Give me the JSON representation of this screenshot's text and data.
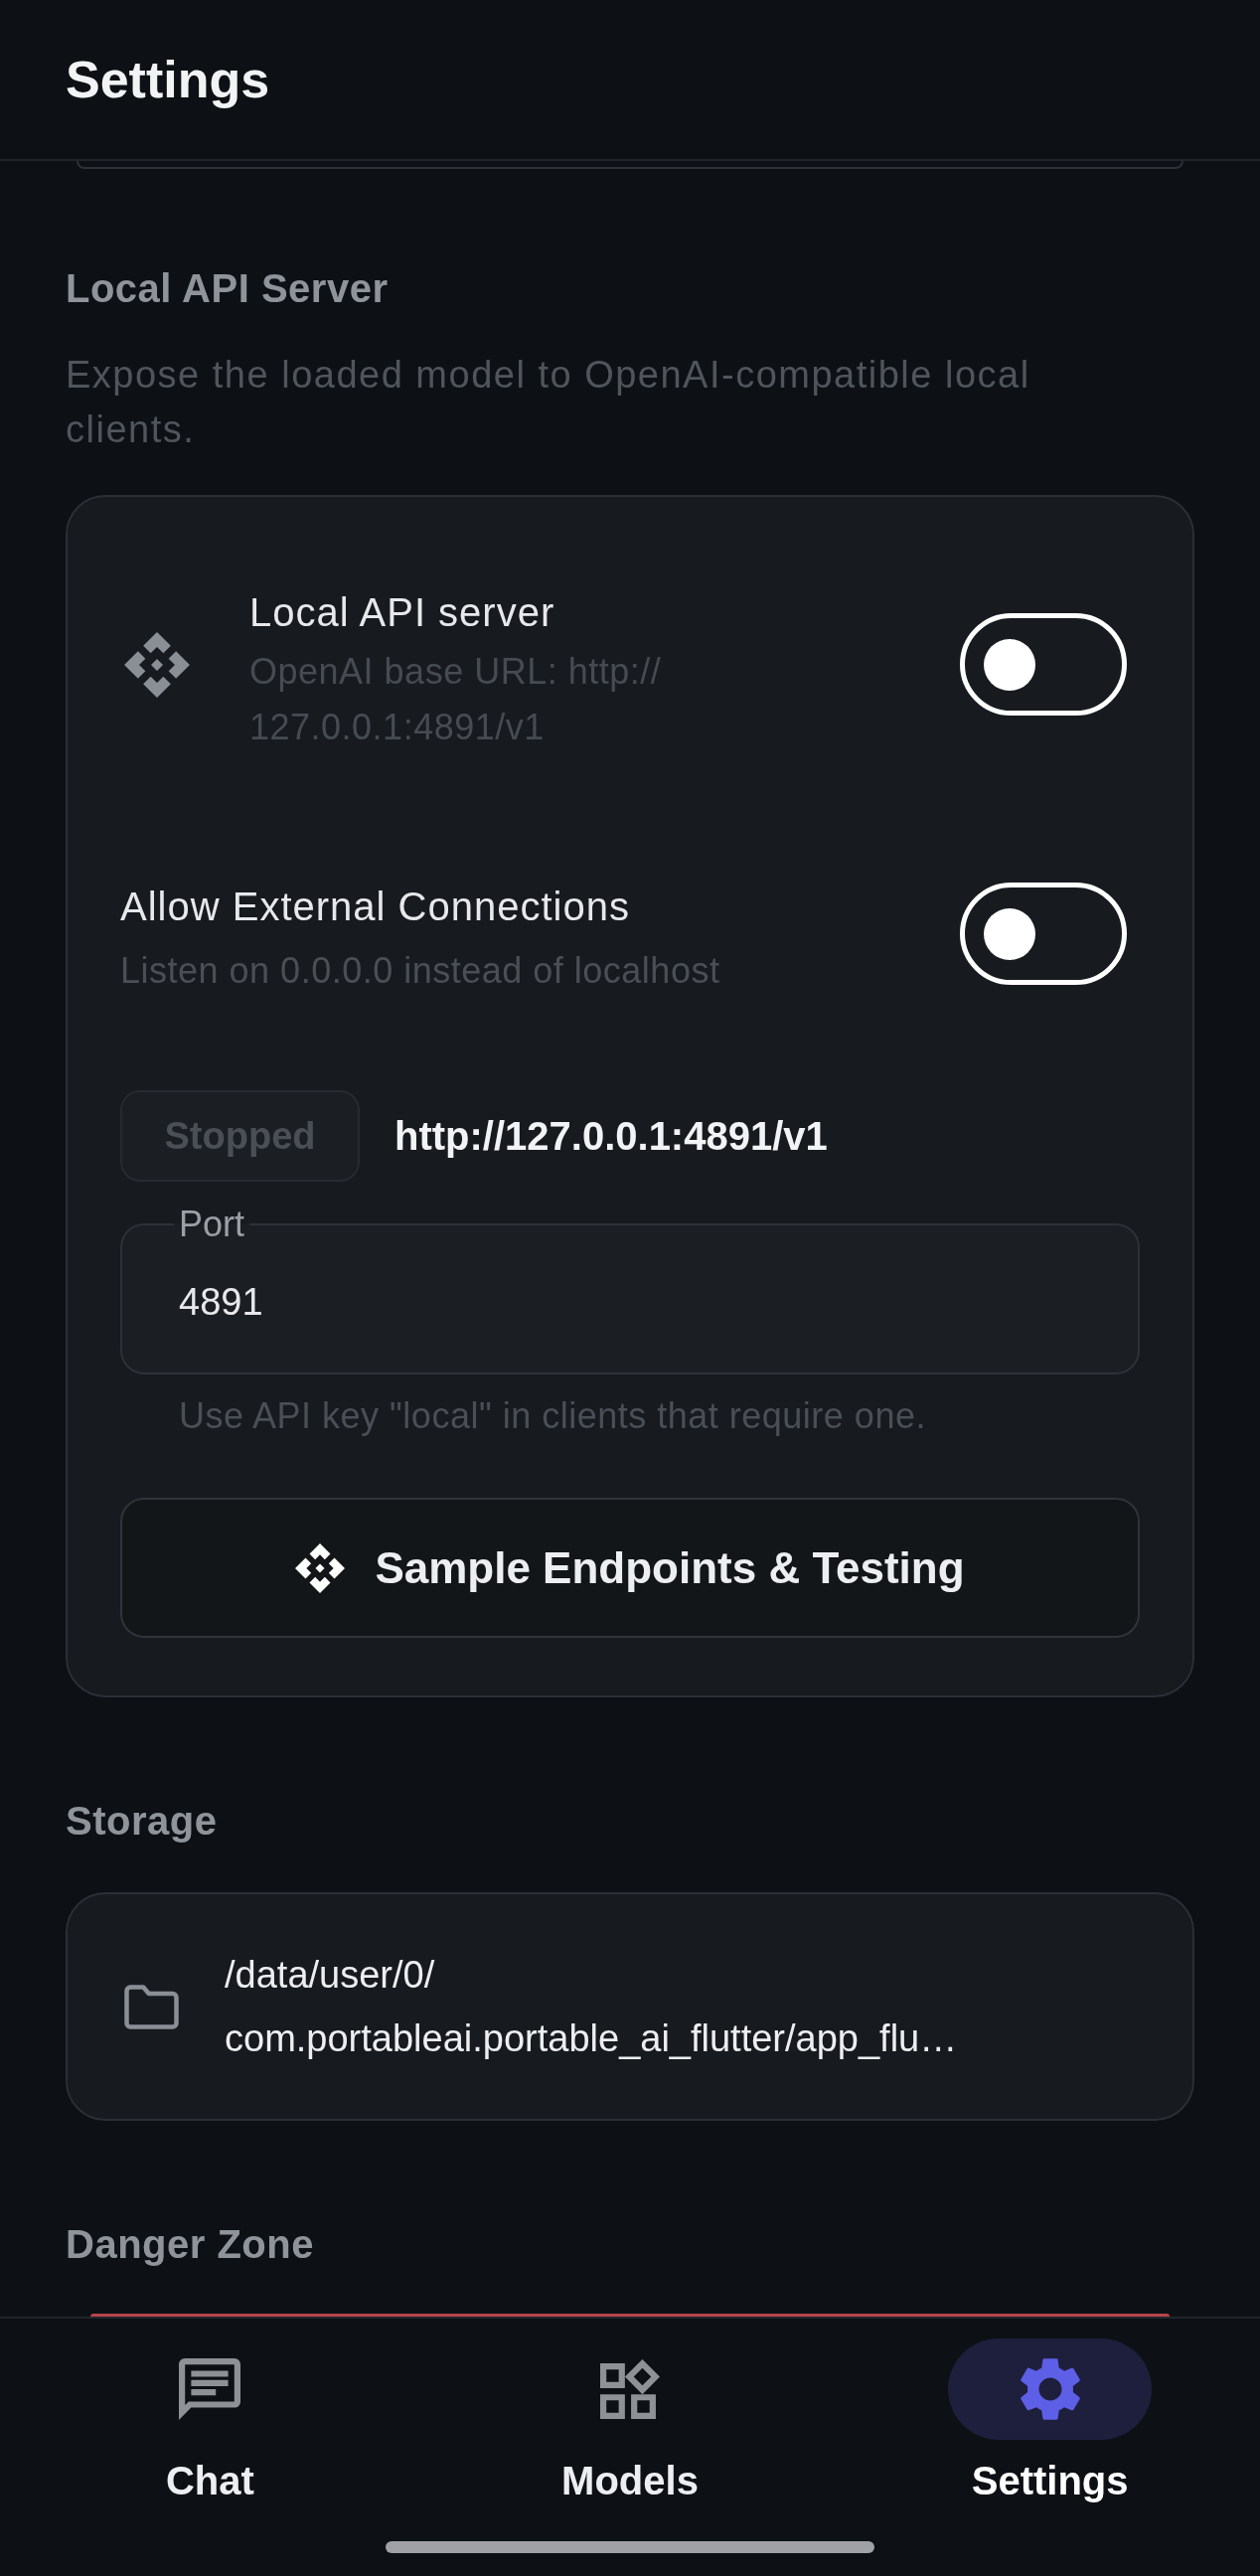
{
  "app_bar": {
    "title": "Settings"
  },
  "local_api_section": {
    "heading": "Local API Server",
    "description": "Expose the loaded model to OpenAI-compatible local clients.",
    "server_toggle": {
      "title": "Local API server",
      "subtitle_lines": [
        "OpenAI base URL: http://",
        "127.0.0.1:4891/v1"
      ],
      "on": false
    },
    "external_toggle": {
      "title": "Allow External Connections",
      "subtitle": "Listen on 0.0.0.0 instead of localhost",
      "on": false
    },
    "status": {
      "label": "Stopped",
      "url": "http://127.0.0.1:4891/v1"
    },
    "port_field": {
      "label": "Port",
      "value": "4891",
      "helper": "Use API key \"local\" in clients that require one."
    },
    "endpoints_button": {
      "label": "Sample Endpoints & Testing"
    }
  },
  "storage_section": {
    "heading": "Storage",
    "path_lines": [
      "/data/user/0/",
      "com.portableai.portable_ai_flutter/app_flu…"
    ]
  },
  "danger_section": {
    "heading": "Danger Zone"
  },
  "bottom_nav": [
    {
      "label": "Chat",
      "selected": false
    },
    {
      "label": "Models",
      "selected": false
    },
    {
      "label": "Settings",
      "selected": true
    }
  ]
}
